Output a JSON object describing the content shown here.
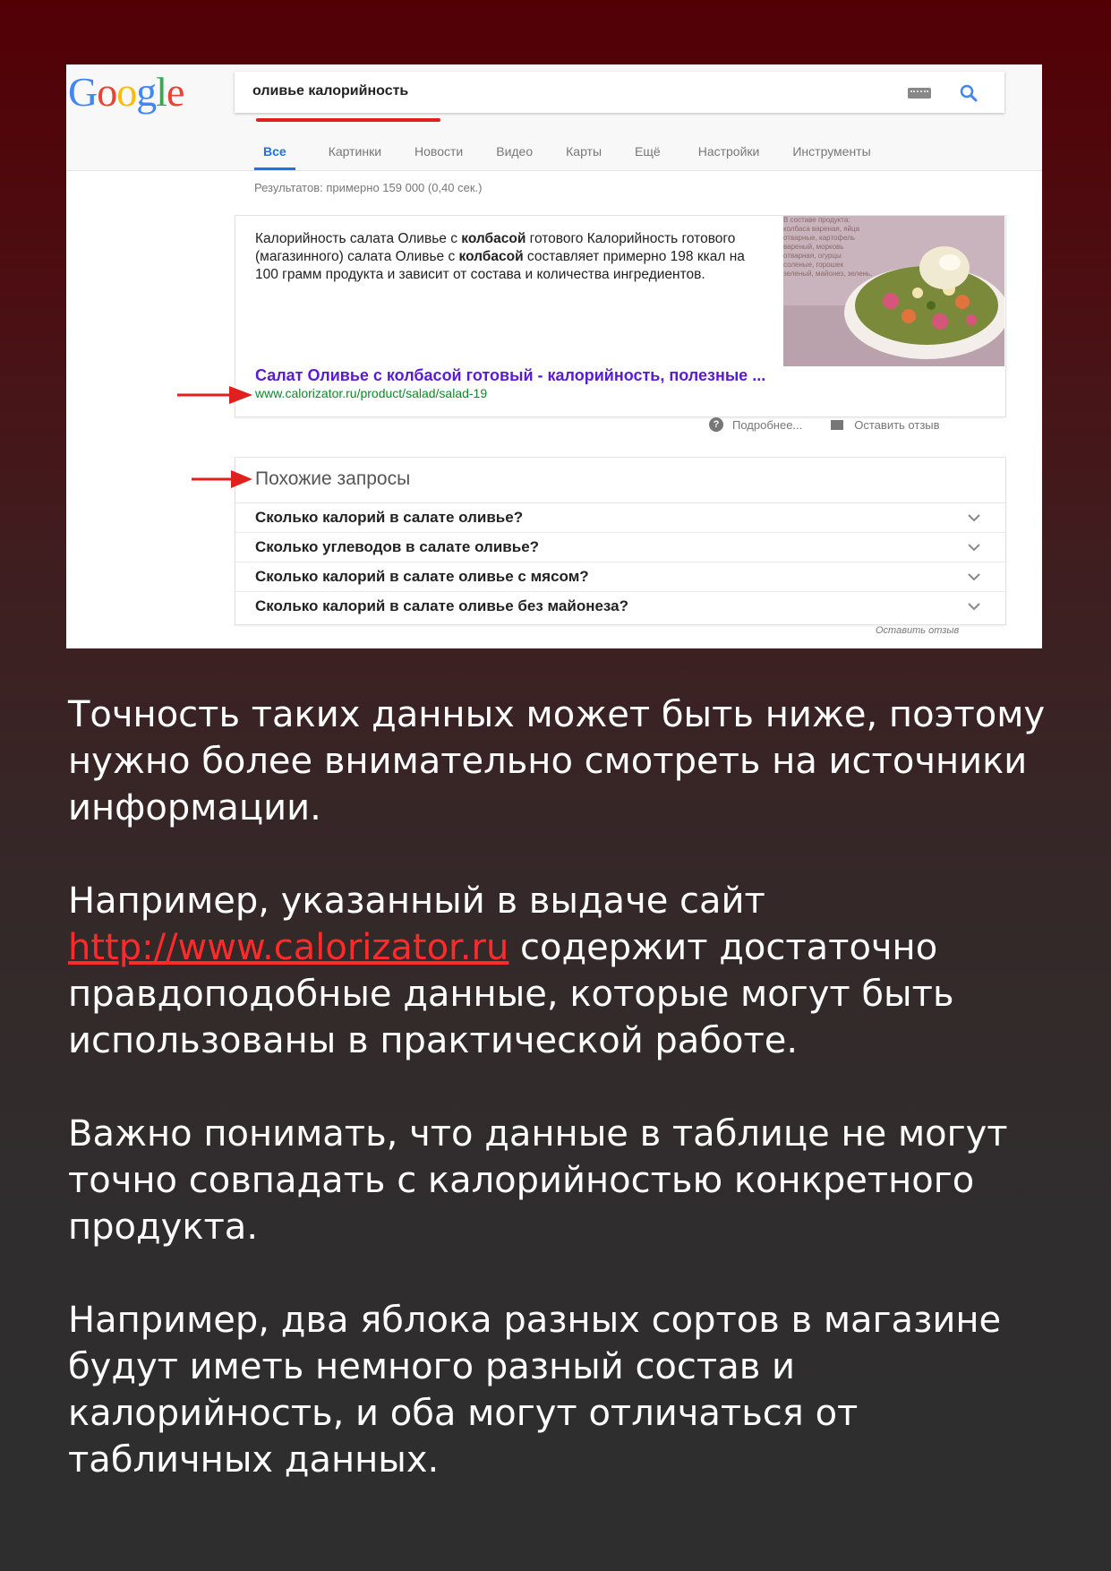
{
  "colors": {
    "accent_red": "#e0201c",
    "link_red": "#ff2a2a",
    "google_blue": "#4285f4",
    "result_link": "#5b1ad6",
    "result_url": "#0a8a2a"
  },
  "google": {
    "logo_letters": [
      "G",
      "o",
      "o",
      "g",
      "l",
      "e"
    ],
    "query": "оливье калорийность",
    "tabs": [
      "Все",
      "Картинки",
      "Новости",
      "Видео",
      "Карты",
      "Ещё",
      "Настройки",
      "Инструменты"
    ],
    "results_count": "Результатов: примерно 159 000 (0,40 сек.)",
    "snippet": {
      "text": [
        {
          "t": "Калорийность салата Оливье с ",
          "b": false
        },
        {
          "t": "колбасой",
          "b": true
        },
        {
          "t": " готового Калорийность готового (магазинного) салата Оливье с ",
          "b": false
        },
        {
          "t": "колбасой",
          "b": true
        },
        {
          "t": " составляет примерно 198 ккал на 100 грамм продукта и зависит от состава и количества ингредиентов.",
          "b": false
        }
      ],
      "image_caption": "В составе продукта: колбаса вареная, яйца отварные, картофель вареный, морковь отварная, огурцы соленые, горошек зеленый, майонез, зелень.",
      "link": "Салат Оливье с колбасой готовый - калорийность, полезные ...",
      "url": "www.calorizator.ru/product/salad/salad-19"
    },
    "more_label": "Подробнее...",
    "feedback_label": "Оставить отзыв",
    "related_title": "Похожие запросы",
    "related_questions": [
      "Сколько калорий в салате оливье?",
      "Сколько углеводов в салате оливье?",
      "Сколько калорий в салате оливье с мясом?",
      "Сколько калорий в салате оливье без майонеза?"
    ],
    "feedback_label_2": "Оставить отзыв"
  },
  "article": {
    "paragraph1": "Точность таких данных может быть ниже, поэтому нужно более внимательно смотреть на источники информации.",
    "paragraph2_before": "Например, указанный в выдаче сайт ",
    "paragraph2_link": "http://www.calorizator.ru",
    "paragraph2_after": " содержит достаточно правдоподобные данные, которые могут быть использованы в практической работе.",
    "paragraph3": "Важно понимать, что данные в таблице не могут точно совпадать с калорийностью конкретного продукта.",
    "paragraph4": "Например, два яблока разных сортов в магазине будут иметь немного разный состав и калорийность, и оба могут отличаться от табличных данных."
  }
}
